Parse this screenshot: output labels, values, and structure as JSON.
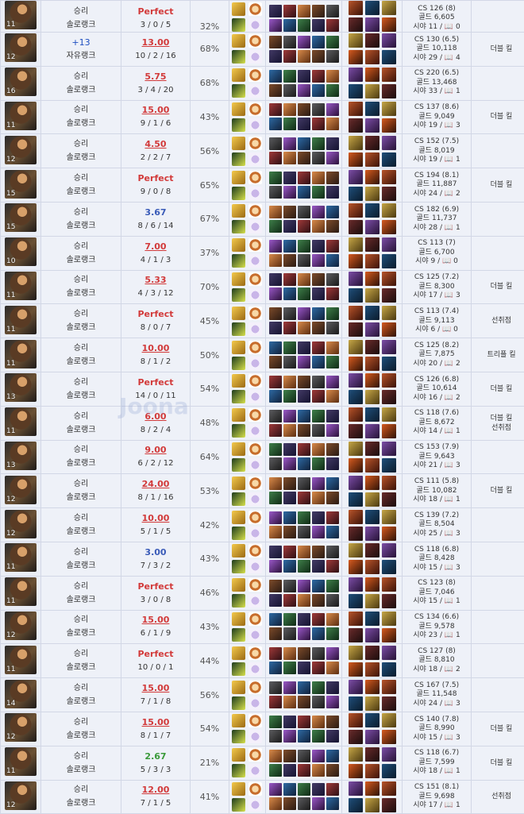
{
  "accent_colors": {
    "red": "#d23a3a",
    "blue": "#3a5bb8",
    "green": "#3a9a3a",
    "row_bg": "#eef1f8",
    "border": "#d2d7e6"
  },
  "watermark": "Joona",
  "rows": [
    {
      "level": "11",
      "result": "승리",
      "queue": "솔로랭크",
      "kda_ratio": "Perfect",
      "kda_style": "perfect",
      "kda": "3 / 0 / 5",
      "kp": "32%",
      "cs": "CS 126 (8)",
      "gold": "골드 6,605",
      "vision": "시야 11 / 📖 0",
      "multi": ""
    },
    {
      "level": "12",
      "result": "+13",
      "queue": "자유랭크",
      "kda_ratio": "13.00",
      "kda_style": "red",
      "kda": "10 / 2 / 16",
      "kp": "68%",
      "cs": "CS 130 (6.5)",
      "gold": "골드 10,118",
      "vision": "시야 29 / 📖 4",
      "multi": "더블 킬"
    },
    {
      "level": "16",
      "result": "승리",
      "queue": "솔로랭크",
      "kda_ratio": "5.75",
      "kda_style": "red",
      "kda": "3 / 4 / 20",
      "kp": "68%",
      "cs": "CS 220 (6.5)",
      "gold": "골드 13,468",
      "vision": "시야 33 / 📖 1",
      "multi": ""
    },
    {
      "level": "11",
      "result": "승리",
      "queue": "솔로랭크",
      "kda_ratio": "15.00",
      "kda_style": "red",
      "kda": "9 / 1 / 6",
      "kp": "43%",
      "cs": "CS 137 (8.6)",
      "gold": "골드 9,049",
      "vision": "시야 19 / 📖 3",
      "multi": "더블 킬"
    },
    {
      "level": "12",
      "result": "승리",
      "queue": "솔로랭크",
      "kda_ratio": "4.50",
      "kda_style": "red",
      "kda": "2 / 2 / 7",
      "kp": "56%",
      "cs": "CS 152 (7.5)",
      "gold": "골드 8,019",
      "vision": "시야 19 / 📖 1",
      "multi": ""
    },
    {
      "level": "15",
      "result": "승리",
      "queue": "솔로랭크",
      "kda_ratio": "Perfect",
      "kda_style": "perfect",
      "kda": "9 / 0 / 8",
      "kp": "65%",
      "cs": "CS 194 (8.1)",
      "gold": "골드 11,887",
      "vision": "시야 24 / 📖 2",
      "multi": "더블 킬"
    },
    {
      "level": "15",
      "result": "승리",
      "queue": "솔로랭크",
      "kda_ratio": "3.67",
      "kda_style": "blue",
      "kda": "8 / 6 / 14",
      "kp": "67%",
      "cs": "CS 182 (6.9)",
      "gold": "골드 11,737",
      "vision": "시야 28 / 📖 1",
      "multi": ""
    },
    {
      "level": "10",
      "result": "승리",
      "queue": "솔로랭크",
      "kda_ratio": "7.00",
      "kda_style": "red",
      "kda": "4 / 1 / 3",
      "kp": "37%",
      "cs": "CS 113 (7)",
      "gold": "골드 6,700",
      "vision": "시야 9 / 📖 0",
      "multi": ""
    },
    {
      "level": "11",
      "result": "승리",
      "queue": "솔로랭크",
      "kda_ratio": "5.33",
      "kda_style": "red",
      "kda": "4 / 3 / 12",
      "kp": "70%",
      "cs": "CS 125 (7.2)",
      "gold": "골드 8,300",
      "vision": "시야 17 / 📖 3",
      "multi": "더블 킬"
    },
    {
      "level": "11",
      "result": "승리",
      "queue": "솔로랭크",
      "kda_ratio": "Perfect",
      "kda_style": "perfect",
      "kda": "8 / 0 / 7",
      "kp": "45%",
      "cs": "CS 113 (7.4)",
      "gold": "골드 9,113",
      "vision": "시야 6 / 📖 0",
      "multi": "선취점"
    },
    {
      "level": "11",
      "result": "승리",
      "queue": "솔로랭크",
      "kda_ratio": "10.00",
      "kda_style": "red",
      "kda": "8 / 1 / 2",
      "kp": "50%",
      "cs": "CS 125 (8.2)",
      "gold": "골드 7,875",
      "vision": "시야 20 / 📖 2",
      "multi": "트리플 킬"
    },
    {
      "level": "13",
      "result": "승리",
      "queue": "솔로랭크",
      "kda_ratio": "Perfect",
      "kda_style": "perfect",
      "kda": "14 / 0 / 11",
      "kp": "54%",
      "cs": "CS 126 (6.8)",
      "gold": "골드 10,614",
      "vision": "시야 16 / 📖 2",
      "multi": "더블 킬"
    },
    {
      "level": "11",
      "result": "승리",
      "queue": "솔로랭크",
      "kda_ratio": "6.00",
      "kda_style": "red",
      "kda": "8 / 2 / 4",
      "kp": "48%",
      "cs": "CS 118 (7.6)",
      "gold": "골드 8,672",
      "vision": "시야 14 / 📖 1",
      "multi": "더블 킬\n선취점"
    },
    {
      "level": "13",
      "result": "승리",
      "queue": "솔로랭크",
      "kda_ratio": "9.00",
      "kda_style": "red",
      "kda": "6 / 2 / 12",
      "kp": "64%",
      "cs": "CS 153 (7.9)",
      "gold": "골드 9,643",
      "vision": "시야 21 / 📖 3",
      "multi": ""
    },
    {
      "level": "12",
      "result": "승리",
      "queue": "솔로랭크",
      "kda_ratio": "24.00",
      "kda_style": "red",
      "kda": "8 / 1 / 16",
      "kp": "53%",
      "cs": "CS 111 (5.8)",
      "gold": "골드 10,082",
      "vision": "시야 18 / 📖 1",
      "multi": "더블 킬"
    },
    {
      "level": "12",
      "result": "승리",
      "queue": "솔로랭크",
      "kda_ratio": "10.00",
      "kda_style": "red",
      "kda": "5 / 1 / 5",
      "kp": "42%",
      "cs": "CS 139 (7.2)",
      "gold": "골드 8,504",
      "vision": "시야 25 / 📖 3",
      "multi": ""
    },
    {
      "level": "11",
      "result": "승리",
      "queue": "솔로랭크",
      "kda_ratio": "3.00",
      "kda_style": "blue",
      "kda": "7 / 3 / 2",
      "kp": "43%",
      "cs": "CS 118 (6.8)",
      "gold": "골드 8,428",
      "vision": "시야 15 / 📖 3",
      "multi": ""
    },
    {
      "level": "11",
      "result": "승리",
      "queue": "솔로랭크",
      "kda_ratio": "Perfect",
      "kda_style": "perfect",
      "kda": "3 / 0 / 8",
      "kp": "46%",
      "cs": "CS 123 (8)",
      "gold": "골드 7,046",
      "vision": "시야 15 / 📖 1",
      "multi": ""
    },
    {
      "level": "12",
      "result": "승리",
      "queue": "솔로랭크",
      "kda_ratio": "15.00",
      "kda_style": "red",
      "kda": "6 / 1 / 9",
      "kp": "43%",
      "cs": "CS 134 (6.6)",
      "gold": "골드 9,578",
      "vision": "시야 23 / 📖 1",
      "multi": ""
    },
    {
      "level": "11",
      "result": "승리",
      "queue": "솔로랭크",
      "kda_ratio": "Perfect",
      "kda_style": "perfect",
      "kda": "10 / 0 / 1",
      "kp": "44%",
      "cs": "CS 127 (8)",
      "gold": "골드 8,810",
      "vision": "시야 18 / 📖 2",
      "multi": ""
    },
    {
      "level": "14",
      "result": "승리",
      "queue": "솔로랭크",
      "kda_ratio": "15.00",
      "kda_style": "red",
      "kda": "7 / 1 / 8",
      "kp": "56%",
      "cs": "CS 167 (7.5)",
      "gold": "골드 11,548",
      "vision": "시야 24 / 📖 3",
      "multi": ""
    },
    {
      "level": "12",
      "result": "승리",
      "queue": "솔로랭크",
      "kda_ratio": "15.00",
      "kda_style": "red",
      "kda": "8 / 1 / 7",
      "kp": "54%",
      "cs": "CS 140 (7.8)",
      "gold": "골드 8,990",
      "vision": "시야 15 / 📖 3",
      "multi": "더블 킬"
    },
    {
      "level": "11",
      "result": "승리",
      "queue": "솔로랭크",
      "kda_ratio": "2.67",
      "kda_style": "green",
      "kda": "5 / 3 / 3",
      "kp": "21%",
      "cs": "CS 118 (6.7)",
      "gold": "골드 7,599",
      "vision": "시야 18 / 📖 1",
      "multi": "더블 킬"
    },
    {
      "level": "12",
      "result": "승리",
      "queue": "솔로랭크",
      "kda_ratio": "12.00",
      "kda_style": "red",
      "kda": "7 / 1 / 5",
      "kp": "41%",
      "cs": "CS 151 (8.1)",
      "gold": "골드 9,698",
      "vision": "시야 17 / 📖 1",
      "multi": "선취점"
    }
  ]
}
